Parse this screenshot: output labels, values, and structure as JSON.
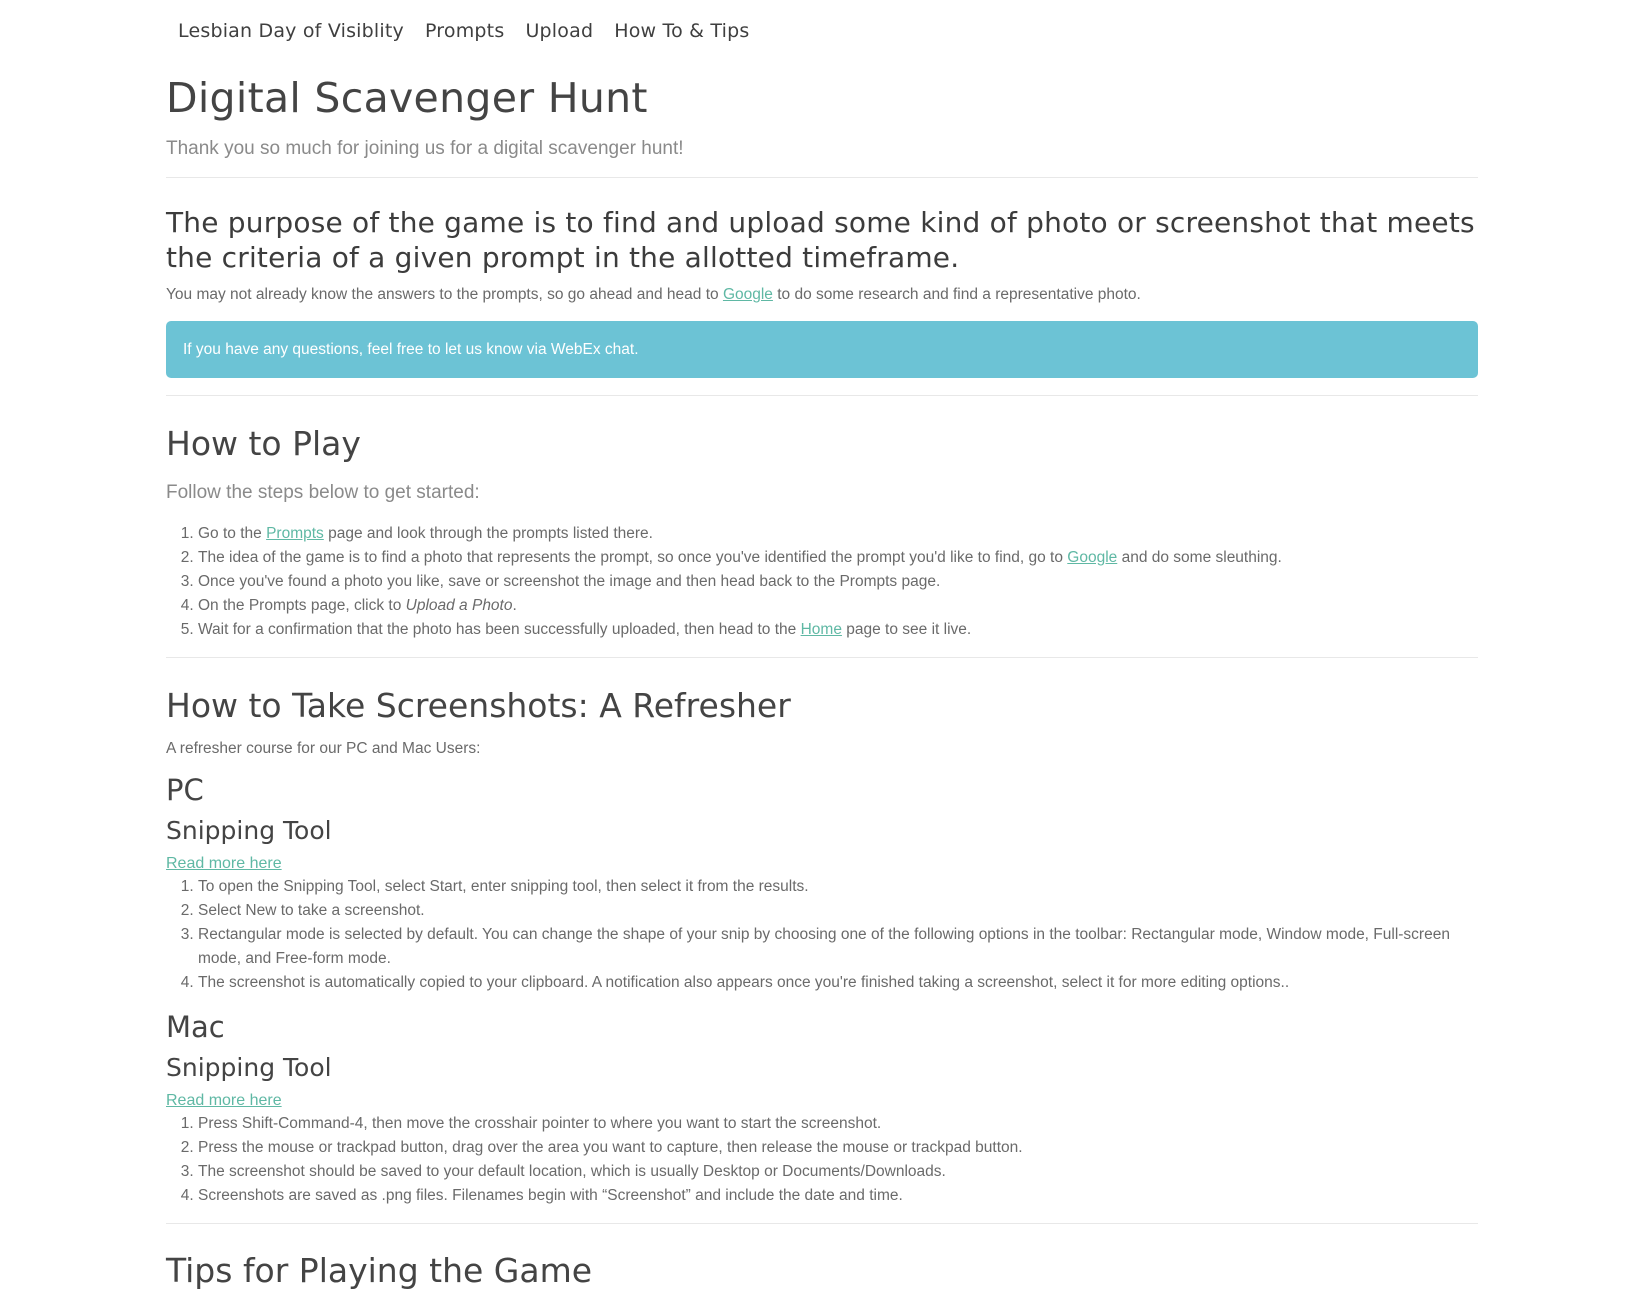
{
  "nav": {
    "items": [
      "Lesbian Day of Visiblity",
      "Prompts",
      "Upload",
      "How To & Tips"
    ]
  },
  "header": {
    "title": "Digital Scavenger Hunt",
    "lead": "Thank you so much for joining us for a digital scavenger hunt!"
  },
  "purpose": {
    "heading": "The purpose of the game is to find and upload some kind of photo or screenshot that meets the criteria of a given prompt in the allotted timeframe.",
    "text_before": "You may not already know the answers to the prompts, so go ahead and head to ",
    "link": "Google",
    "text_after": " to do some research and find a representative photo."
  },
  "alert": {
    "text": "If you have any questions, feel free to let us know via WebEx chat."
  },
  "how_to_play": {
    "heading": "How to Play",
    "subheading": "Follow the steps below to get started:",
    "steps": [
      {
        "before": "Go to the ",
        "link": "Prompts",
        "after": " page and look through the prompts listed there."
      },
      {
        "before": "The idea of the game is to find a photo that represents the prompt, so once you've identified the prompt you'd like to find, go to ",
        "link": "Google",
        "after": " and do some sleuthing."
      },
      {
        "text": "Once you've found a photo you like, save or screenshot the image and then head back to the Prompts page."
      },
      {
        "before": "On the Prompts page, click to ",
        "em": "Upload a Photo",
        "after": "."
      },
      {
        "before": "Wait for a confirmation that the photo has been successfully uploaded, then head to the ",
        "link": "Home",
        "after": " page to see it live."
      }
    ]
  },
  "screenshots": {
    "heading": "How to Take Screenshots: A Refresher",
    "intro": "A refresher course for our PC and Mac Users:",
    "pc": {
      "heading": "PC",
      "tool": "Snipping Tool",
      "read_more": "Read more here",
      "steps": [
        "To open the Snipping Tool, select Start, enter snipping tool, then select it from the results.",
        "Select New to take a screenshot.",
        "Rectangular mode is selected by default. You can change the shape of your snip by choosing one of the following options in the toolbar: Rectangular mode, Window mode, Full-screen mode, and Free-form mode.",
        "The screenshot is automatically copied to your clipboard. A notification also appears once you're finished taking a screenshot, select it for more editing options.."
      ]
    },
    "mac": {
      "heading": "Mac",
      "tool": "Snipping Tool",
      "read_more": "Read more here",
      "steps": [
        "Press Shift-Command-4, then move the crosshair pointer to where you want to start the screenshot.",
        "Press the mouse or trackpad button, drag over the area you want to capture, then release the mouse or trackpad button.",
        "The screenshot should be saved to your default location, which is usually Desktop or Documents/Downloads.",
        "Screenshots are saved as .png files. Filenames begin with “Screenshot” and include the date and time."
      ]
    }
  },
  "tips": {
    "heading": "Tips for Playing the Game"
  },
  "colors": {
    "link": "#5fb8a4",
    "alert_bg": "#6cc3d5",
    "heading": "#444444"
  }
}
